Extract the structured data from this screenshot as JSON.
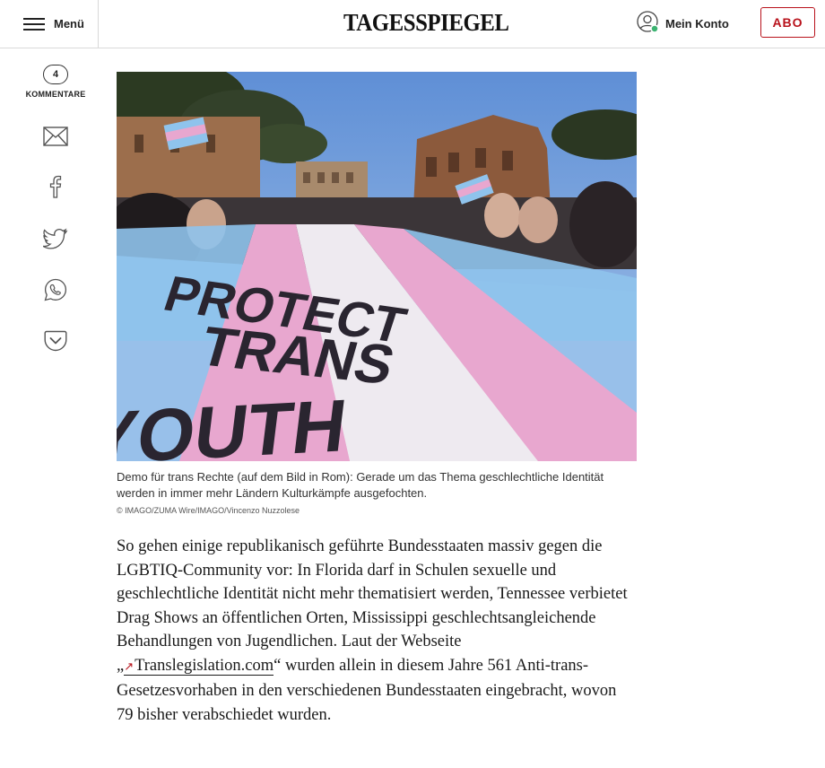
{
  "header": {
    "menu_label": "Menü",
    "logo_text": "TAGESSPIEGEL",
    "account_label": "Mein Konto",
    "abo_label": "ABO"
  },
  "share_rail": {
    "comment_count": "4",
    "comment_label": "KOMMENTARE",
    "icons": [
      "mail-icon",
      "facebook-icon",
      "twitter-icon",
      "whatsapp-icon",
      "pocket-icon"
    ]
  },
  "photo": {
    "banner_lines": [
      "PROTECT",
      "TRANS",
      "YOUTH"
    ]
  },
  "caption": {
    "text": "Demo für trans Rechte (auf dem Bild in Rom): Gerade um das Thema geschlechtliche Identität werden in immer mehr Ländern Kulturkämpfe ausgefochten.",
    "credit": "© IMAGO/ZUMA Wire/IMAGO/Vincenzo Nuzzolese"
  },
  "article": {
    "text_before": "So gehen einige republikanisch geführte Bundesstaaten massiv gegen die LGBTIQ-Community vor: In Florida darf in Schulen sexuelle und geschlechtliche Identität nicht mehr thematisiert werden, Tennessee verbietet Drag Shows an öffentlichen Orten, Mississippi geschlechtsangleichende Behandlungen von Jugendlichen. Laut der Webseite „",
    "link_text": "Translegislation.com",
    "text_after": "“ wurden allein in diesem Jahre 561 Anti-trans-Gesetzesvorhaben in den verschiedenen Bundesstaaten eingebracht, wovon 79 bisher verabschiedet wurden."
  },
  "colors": {
    "brand_red": "#b8121b",
    "online_dot": "#3cb371",
    "flag_blue": "#8fc3ec",
    "flag_pink": "#e8a7cf",
    "flag_white": "#eeeaf0"
  }
}
